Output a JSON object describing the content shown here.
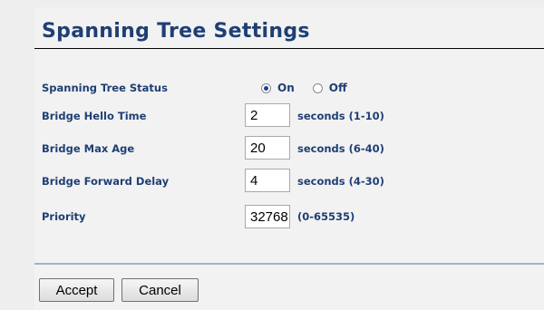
{
  "page": {
    "title": "Spanning Tree Settings"
  },
  "form": {
    "status": {
      "label": "Spanning Tree Status",
      "options": [
        {
          "label": "On",
          "selected": true
        },
        {
          "label": "Off",
          "selected": false
        }
      ]
    },
    "hello_time": {
      "label": "Bridge Hello Time",
      "value": "2",
      "hint": "seconds (1-10)"
    },
    "max_age": {
      "label": "Bridge Max Age",
      "value": "20",
      "hint": "seconds (6-40)"
    },
    "forward_delay": {
      "label": "Bridge Forward Delay",
      "value": "4",
      "hint": "seconds (4-30)"
    },
    "priority": {
      "label": "Priority",
      "value": "32768",
      "hint": "(0-65535)"
    }
  },
  "buttons": {
    "accept_label": "Accept",
    "cancel_label": "Cancel"
  },
  "colors": {
    "label_text": "#1f3f74",
    "page_background": "#f2f2f2",
    "divider": "#a3b3c5"
  }
}
